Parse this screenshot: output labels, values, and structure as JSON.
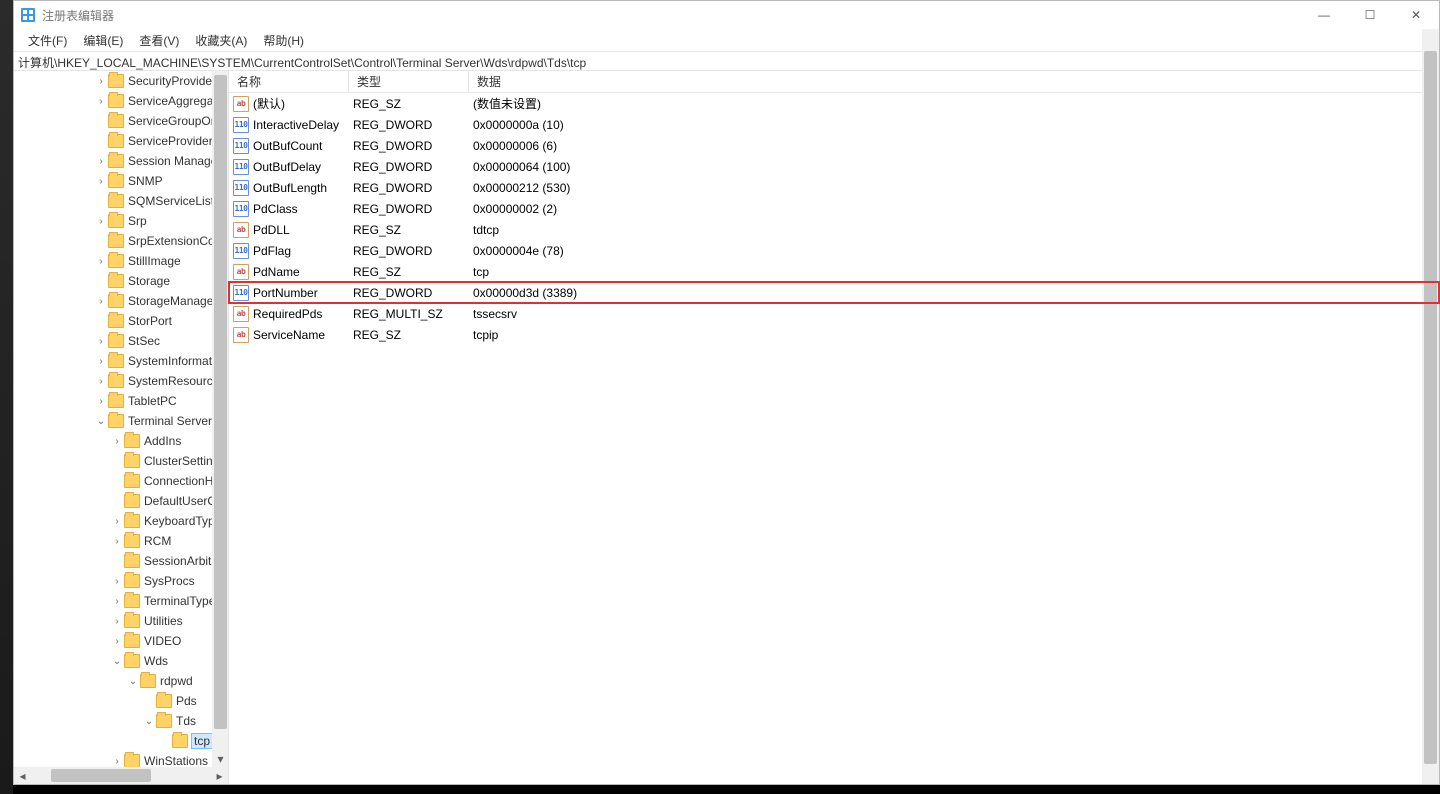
{
  "window": {
    "title": "注册表编辑器"
  },
  "menu": {
    "file": "文件(F)",
    "edit": "编辑(E)",
    "view": "查看(V)",
    "favorites": "收藏夹(A)",
    "help": "帮助(H)"
  },
  "address": "计算机\\HKEY_LOCAL_MACHINE\\SYSTEM\\CurrentControlSet\\Control\\Terminal Server\\Wds\\rdpwd\\Tds\\tcp",
  "tree": [
    {
      "indent": 5,
      "twisty": ">",
      "label": "SecurityProviders"
    },
    {
      "indent": 5,
      "twisty": ">",
      "label": "ServiceAggregat"
    },
    {
      "indent": 5,
      "twisty": "",
      "label": "ServiceGroupOrd"
    },
    {
      "indent": 5,
      "twisty": "",
      "label": "ServiceProvider"
    },
    {
      "indent": 5,
      "twisty": ">",
      "label": "Session Manage"
    },
    {
      "indent": 5,
      "twisty": ">",
      "label": "SNMP"
    },
    {
      "indent": 5,
      "twisty": "",
      "label": "SQMServiceList"
    },
    {
      "indent": 5,
      "twisty": ">",
      "label": "Srp"
    },
    {
      "indent": 5,
      "twisty": "",
      "label": "SrpExtensionCon"
    },
    {
      "indent": 5,
      "twisty": ">",
      "label": "StillImage"
    },
    {
      "indent": 5,
      "twisty": "",
      "label": "Storage"
    },
    {
      "indent": 5,
      "twisty": ">",
      "label": "StorageManager"
    },
    {
      "indent": 5,
      "twisty": "",
      "label": "StorPort"
    },
    {
      "indent": 5,
      "twisty": ">",
      "label": "StSec"
    },
    {
      "indent": 5,
      "twisty": ">",
      "label": "SystemInformati"
    },
    {
      "indent": 5,
      "twisty": ">",
      "label": "SystemResource"
    },
    {
      "indent": 5,
      "twisty": ">",
      "label": "TabletPC"
    },
    {
      "indent": 5,
      "twisty": "v",
      "label": "Terminal Server"
    },
    {
      "indent": 6,
      "twisty": ">",
      "label": "AddIns"
    },
    {
      "indent": 6,
      "twisty": "",
      "label": "ClusterSettings"
    },
    {
      "indent": 6,
      "twisty": "",
      "label": "ConnectionHa"
    },
    {
      "indent": 6,
      "twisty": "",
      "label": "DefaultUserCo"
    },
    {
      "indent": 6,
      "twisty": ">",
      "label": "KeyboardType"
    },
    {
      "indent": 6,
      "twisty": ">",
      "label": "RCM"
    },
    {
      "indent": 6,
      "twisty": "",
      "label": "SessionArbitra"
    },
    {
      "indent": 6,
      "twisty": ">",
      "label": "SysProcs"
    },
    {
      "indent": 6,
      "twisty": ">",
      "label": "TerminalTypes"
    },
    {
      "indent": 6,
      "twisty": ">",
      "label": "Utilities"
    },
    {
      "indent": 6,
      "twisty": ">",
      "label": "VIDEO"
    },
    {
      "indent": 6,
      "twisty": "v",
      "label": "Wds"
    },
    {
      "indent": 7,
      "twisty": "v",
      "label": "rdpwd"
    },
    {
      "indent": 8,
      "twisty": "",
      "label": "Pds"
    },
    {
      "indent": 8,
      "twisty": "v",
      "label": "Tds"
    },
    {
      "indent": 9,
      "twisty": "",
      "label": "tcp",
      "selected": true
    },
    {
      "indent": 6,
      "twisty": ">",
      "label": "WinStations"
    }
  ],
  "list": {
    "headers": {
      "name": "名称",
      "type": "类型",
      "data": "数据"
    },
    "rows": [
      {
        "icon": "sz",
        "name": "(默认)",
        "type": "REG_SZ",
        "data": "(数值未设置)"
      },
      {
        "icon": "bin",
        "name": "InteractiveDelay",
        "type": "REG_DWORD",
        "data": "0x0000000a (10)"
      },
      {
        "icon": "bin",
        "name": "OutBufCount",
        "type": "REG_DWORD",
        "data": "0x00000006 (6)"
      },
      {
        "icon": "bin",
        "name": "OutBufDelay",
        "type": "REG_DWORD",
        "data": "0x00000064 (100)"
      },
      {
        "icon": "bin",
        "name": "OutBufLength",
        "type": "REG_DWORD",
        "data": "0x00000212 (530)"
      },
      {
        "icon": "bin",
        "name": "PdClass",
        "type": "REG_DWORD",
        "data": "0x00000002 (2)"
      },
      {
        "icon": "sz",
        "name": "PdDLL",
        "type": "REG_SZ",
        "data": "tdtcp"
      },
      {
        "icon": "bin",
        "name": "PdFlag",
        "type": "REG_DWORD",
        "data": "0x0000004e (78)"
      },
      {
        "icon": "sz",
        "name": "PdName",
        "type": "REG_SZ",
        "data": "tcp"
      },
      {
        "icon": "bin",
        "name": "PortNumber",
        "type": "REG_DWORD",
        "data": "0x00000d3d (3389)",
        "highlight": true
      },
      {
        "icon": "sz",
        "name": "RequiredPds",
        "type": "REG_MULTI_SZ",
        "data": "tssecsrv"
      },
      {
        "icon": "sz",
        "name": "ServiceName",
        "type": "REG_SZ",
        "data": "tcpip"
      }
    ]
  },
  "glyphs": {
    "min": "—",
    "max": "☐",
    "close": "✕",
    "left": "◂",
    "right": "▸",
    "up": "▴",
    "down": "▾"
  },
  "icon_text": {
    "sz": "ab",
    "bin": "110"
  }
}
